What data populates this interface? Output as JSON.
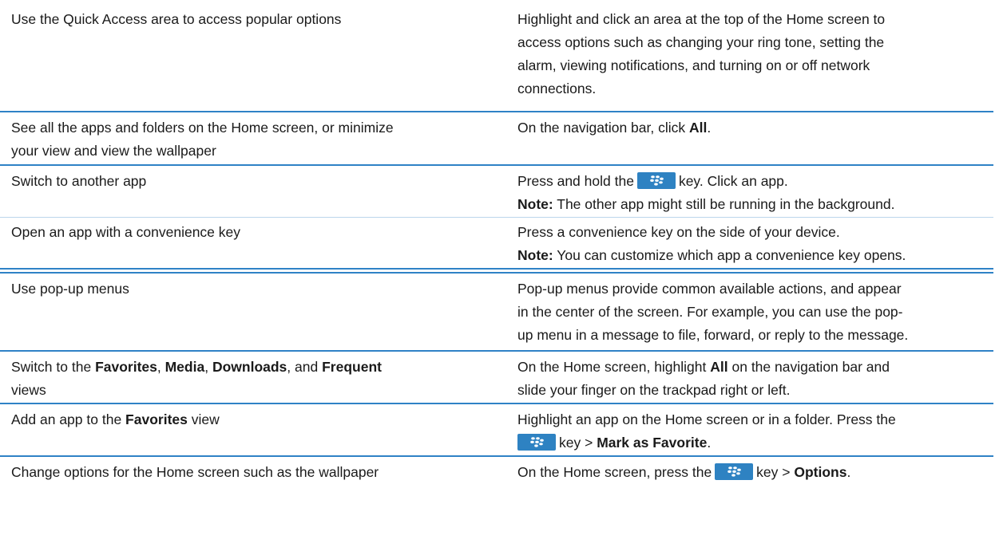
{
  "rows": [
    {
      "task": [
        "Use the Quick Access area to access popular options"
      ],
      "action": [
        "Highlight and click an area at the top of the Home screen to",
        "access options such as changing your ring tone, setting the",
        "alarm, viewing notifications, and turning on or off network",
        "connections."
      ]
    },
    {
      "task": [
        "See all the apps and folders on the Home screen, or minimize",
        "your view and view the wallpaper"
      ],
      "action": {
        "pre": "On the navigation bar, click ",
        "bold": "All",
        "post": "."
      }
    },
    {
      "task": [
        "Switch to another app"
      ],
      "action": {
        "pre": "Press and hold the",
        "post": "key. Click an app."
      },
      "note_label": "Note:",
      "note": " The other app might still be running in the background."
    },
    {
      "task": [
        "Open an app with a convenience key"
      ],
      "action": "Press a convenience key on the side of your device.",
      "note_label": "Note:",
      "note": " You can customize which app a convenience key opens."
    },
    {
      "task": [
        "Use pop-up menus"
      ],
      "action": [
        "Pop-up menus provide common available actions, and appear",
        "in the center of the screen. For example, you can use the pop-",
        "up menu in a message to file, forward, or reply to the message."
      ]
    },
    {
      "task": {
        "p1": "Switch to the ",
        "b1": "Favorites",
        "p2": ", ",
        "b2": "Media",
        "p3": ", ",
        "b3": "Downloads",
        "p4": ", and ",
        "b4": "Frequent",
        "line2": "views"
      },
      "action": {
        "pre": "On the Home screen, highlight ",
        "bold": "All",
        "post": " on the navigation bar and",
        "line2": "slide your finger on the trackpad right or left."
      }
    },
    {
      "task": {
        "pre": "Add an app to the ",
        "bold": "Favorites",
        "post": " view"
      },
      "action": {
        "line1": "Highlight an app on the Home screen or in a folder. Press the",
        "post": "key > ",
        "bold": "Mark as Favorite",
        "end": "."
      }
    },
    {
      "task": [
        "Change options for the Home screen such as the wallpaper"
      ],
      "action": {
        "pre": "On the Home screen, press the",
        "post": "key > ",
        "bold": "Options",
        "end": "."
      }
    }
  ],
  "icons": {
    "key_icon": "blackberry-menu-key-icon",
    "key_color": "#2e82c2"
  }
}
